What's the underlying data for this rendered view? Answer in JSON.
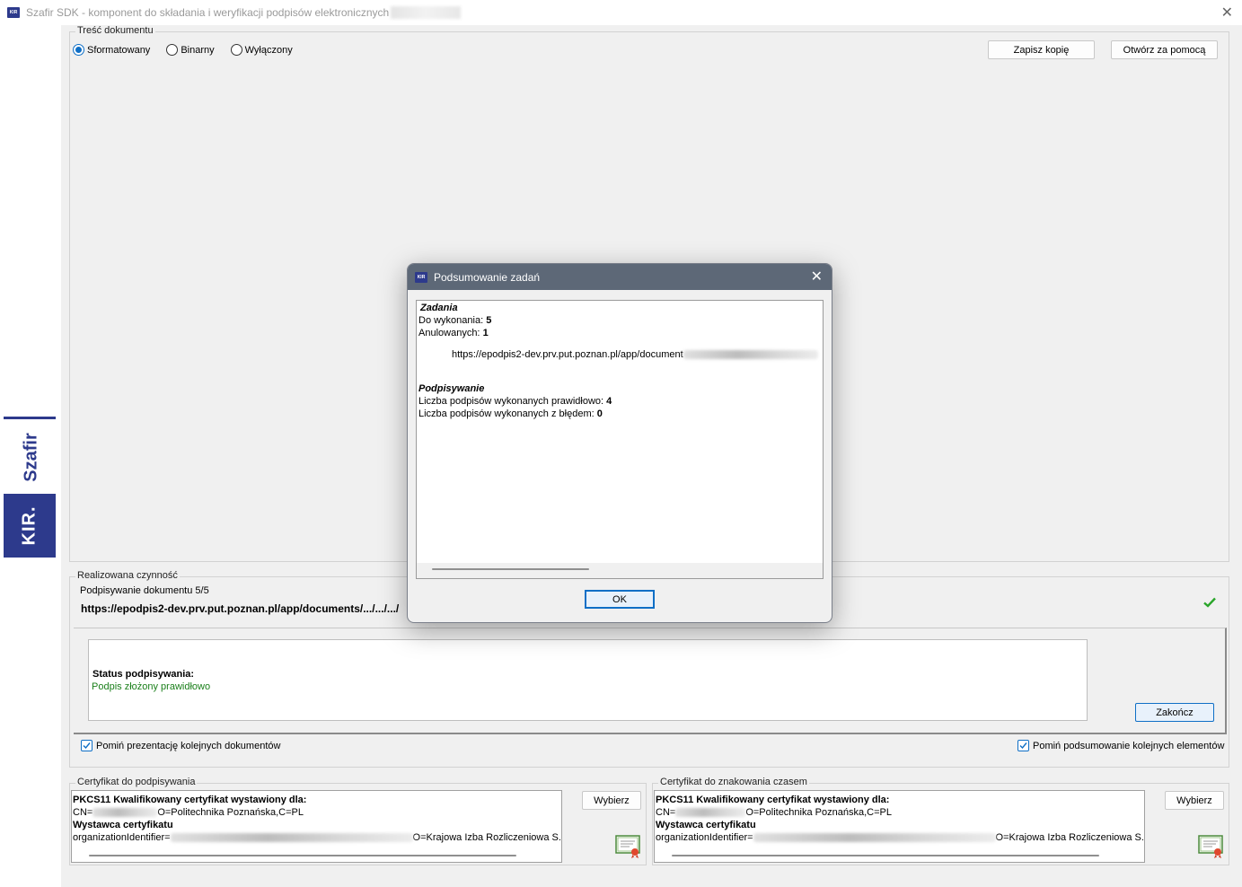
{
  "window": {
    "title": "Szafir SDK - komponent do składania i weryfikacji podpisów elektronicznych",
    "close_glyph": "✕"
  },
  "brand": {
    "name": "Szafir",
    "company": "KIR.",
    "icon_text": "KIR",
    "color": "#2d3a8c"
  },
  "document_content": {
    "legend": "Treść dokumentu",
    "radio_options": [
      {
        "label": "Sformatowany",
        "selected": true
      },
      {
        "label": "Binarny",
        "selected": false
      },
      {
        "label": "Wyłączony",
        "selected": false
      }
    ],
    "save_copy_label": "Zapisz kopię",
    "open_with_label": "Otwórz za pomocą"
  },
  "current_action": {
    "legend": "Realizowana czynność",
    "step_text": "Podpisywanie dokumentu 5/5",
    "url": "https://epodpis2-dev.prv.put.poznan.pl/app/documents/.../.../.../"
  },
  "status": {
    "heading": "Status podpisywania:",
    "message": "Podpis złożony prawidłowo",
    "message_color": "#1a7f1a",
    "finish_label": "Zakończ"
  },
  "options": {
    "skip_presentation": {
      "label": "Pomiń prezentację kolejnych dokumentów",
      "checked": true
    },
    "skip_summary": {
      "label": "Pomiń podsumowanie kolejnych elementów",
      "checked": true
    }
  },
  "signing_cert": {
    "legend": "Certyfikat do podpisywania",
    "line1": "PKCS11 Kwalifikowany certyfikat wystawiony dla:",
    "cn_prefix": "CN=",
    "cn_suffix": "O=Politechnika Poznańska,C=PL",
    "issuer_heading": "Wystawca certyfikatu",
    "issuer_prefix": "organizationIdentifier=",
    "issuer_suffix": "O=Krajowa Izba Rozliczeniowa S.A",
    "choose_label": "Wybierz"
  },
  "timestamp_cert": {
    "legend": "Certyfikat do znakowania czasem",
    "line1": "PKCS11 Kwalifikowany certyfikat wystawiony dla:",
    "cn_prefix": "CN=",
    "cn_suffix": "O=Politechnika Poznańska,C=PL",
    "issuer_heading": "Wystawca certyfikatu",
    "issuer_prefix": "organizationIdentifier=",
    "issuer_suffix": "O=Krajowa Izba Rozliczeniowa S.A",
    "choose_label": "Wybierz"
  },
  "dialog": {
    "title": "Podsumowanie zadań",
    "close_glyph": "✕",
    "tasks_heading": "Zadania",
    "to_do_label": "Do wykonania:",
    "to_do_value": "5",
    "cancelled_label": "Anulowanych:",
    "cancelled_value": "1",
    "url": "https://epodpis2-dev.prv.put.poznan.pl/app/document",
    "signing_heading": "Podpisywanie",
    "ok_count_label": "Liczba podpisów wykonanych prawidłowo:",
    "ok_count_value": "4",
    "err_count_label": "Liczba podpisów wykonanych z błędem:",
    "err_count_value": "0",
    "ok_label": "OK"
  }
}
